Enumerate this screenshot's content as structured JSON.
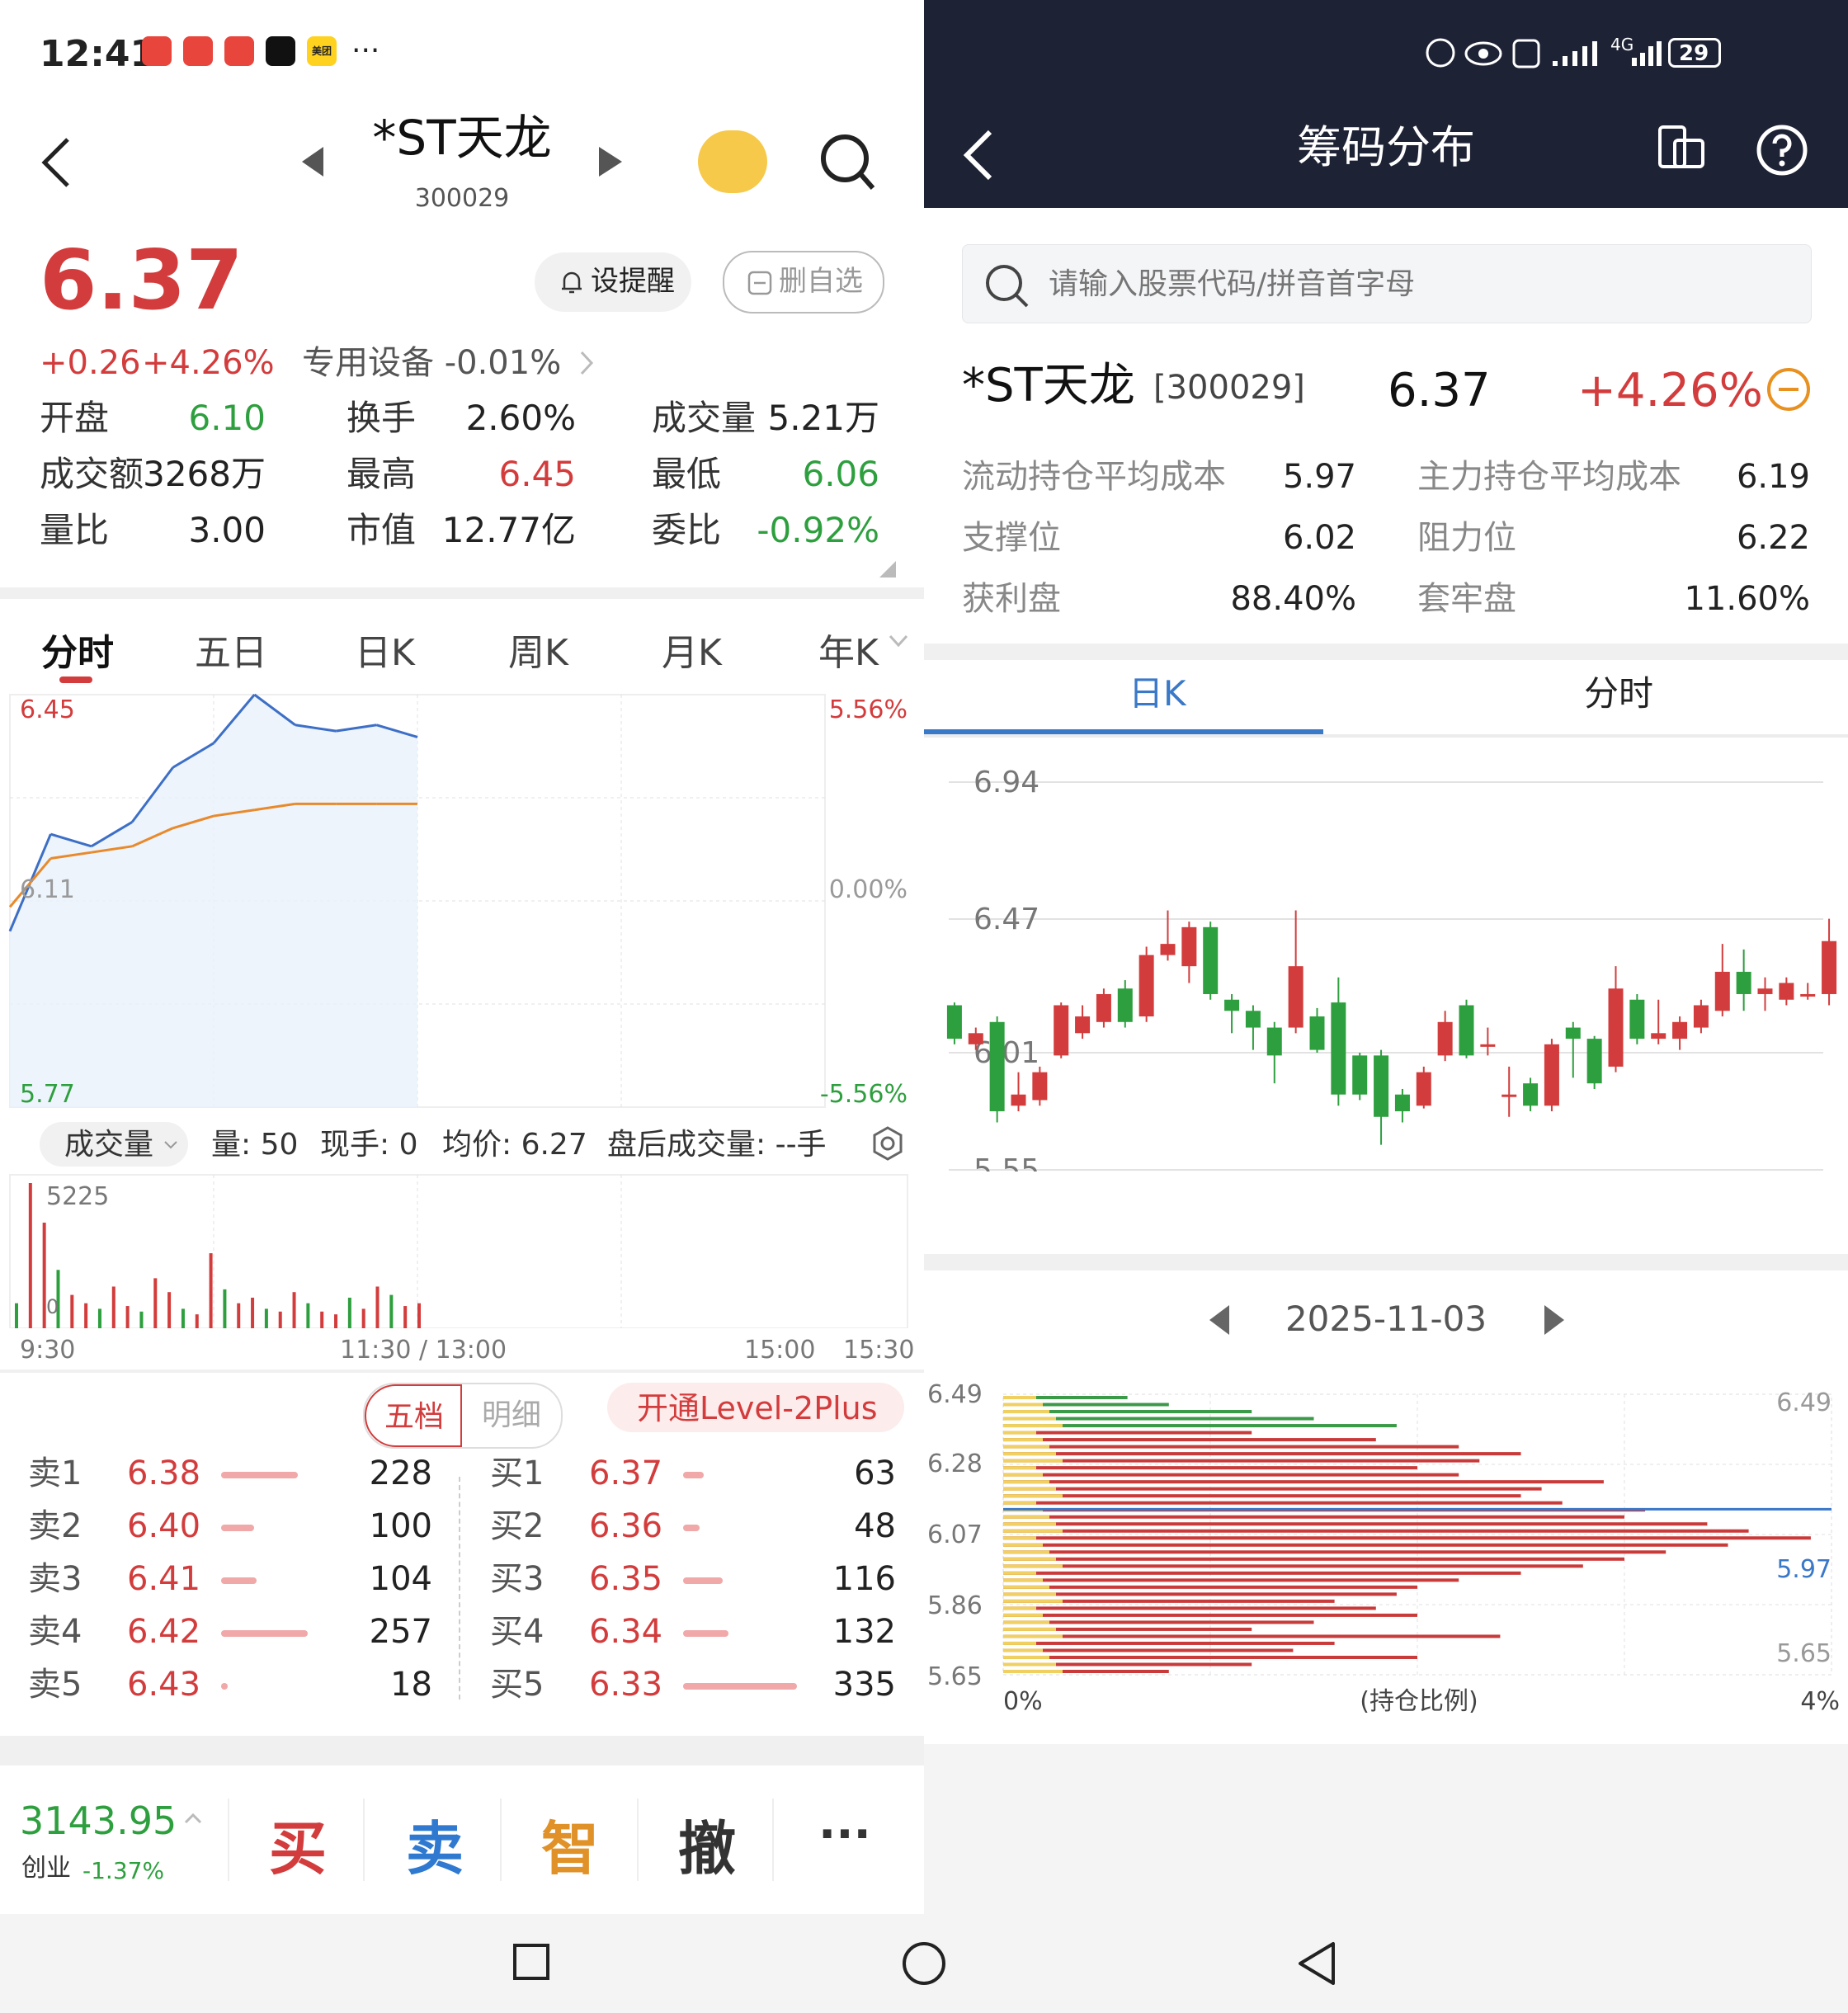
{
  "status_bar": {
    "time": "12:41",
    "more": "···",
    "signal_text": "4G",
    "battery": "29",
    "badge_text": "美团"
  },
  "left": {
    "header": {
      "title": "*ST天龙",
      "code": "300029"
    },
    "price": "6.37",
    "change": "+0.26",
    "change_pct": "+4.26%",
    "remind_label": "设提醒",
    "remove_label": "删自选",
    "sector_text": "专用设备 -0.01%",
    "stats": [
      {
        "label": "开盘",
        "value": "6.10",
        "color": "green"
      },
      {
        "label": "换手",
        "value": "2.60%",
        "color": "black"
      },
      {
        "label": "成交量",
        "value": "5.21万",
        "color": "black"
      },
      {
        "label": "成交额",
        "value": "3268万",
        "color": "black"
      },
      {
        "label": "最高",
        "value": "6.45",
        "color": "red"
      },
      {
        "label": "最低",
        "value": "6.06",
        "color": "green"
      },
      {
        "label": "量比",
        "value": "3.00",
        "color": "black"
      },
      {
        "label": "市值",
        "value": "12.77亿",
        "color": "black"
      },
      {
        "label": "委比",
        "value": "-0.92%",
        "color": "green"
      }
    ],
    "tabs": [
      "分时",
      "五日",
      "日K",
      "周K",
      "月K",
      "年K"
    ],
    "active_tab": "分时",
    "intraday": {
      "y_top": "6.45",
      "y_mid": "6.11",
      "y_bottom": "5.77",
      "pct_top": "5.56%",
      "pct_mid": "0.00%",
      "pct_bottom": "-5.56%",
      "info": {
        "vol_dropdown": "成交量",
        "amount": "量: 50",
        "now": "现手: 0",
        "avg": "均价: 6.27",
        "after": "盘后成交量: --手"
      },
      "vol_max": "5225",
      "vol_min": "0",
      "times": [
        "9:30",
        "11:30 / 13:00",
        "15:00",
        "15:30"
      ]
    },
    "orderbook": {
      "tabs": [
        "五档",
        "明细"
      ],
      "level2": "开通Level-2Plus",
      "asks": [
        {
          "label": "卖1",
          "price": "6.38",
          "vol": "228",
          "bar": 0.37
        },
        {
          "label": "卖2",
          "price": "6.40",
          "vol": "100",
          "bar": 0.16
        },
        {
          "label": "卖3",
          "price": "6.41",
          "vol": "104",
          "bar": 0.17
        },
        {
          "label": "卖4",
          "price": "6.42",
          "vol": "257",
          "bar": 0.42
        },
        {
          "label": "卖5",
          "price": "6.43",
          "vol": "18",
          "bar": 0.03
        }
      ],
      "bids": [
        {
          "label": "买1",
          "price": "6.37",
          "vol": "63",
          "bar": 0.1
        },
        {
          "label": "买2",
          "price": "6.36",
          "vol": "48",
          "bar": 0.08
        },
        {
          "label": "买3",
          "price": "6.35",
          "vol": "116",
          "bar": 0.19
        },
        {
          "label": "买4",
          "price": "6.34",
          "vol": "132",
          "bar": 0.22
        },
        {
          "label": "买5",
          "price": "6.33",
          "vol": "335",
          "bar": 0.55
        }
      ]
    },
    "bottom_bar": {
      "index_value": "3143.95",
      "index_name": "创业",
      "index_change": "-1.37%",
      "buy": "买",
      "sell": "卖",
      "smart": "智",
      "cancel": "撤",
      "more": "···"
    }
  },
  "right": {
    "title": "筹码分布",
    "search_placeholder": "请输入股票代码/拼音首字母",
    "stock_name": "*ST天龙",
    "stock_code": "[300029]",
    "price": "6.37",
    "change_pct": "+4.26%",
    "metrics": [
      {
        "label": "流动持仓平均成本",
        "value": "5.97"
      },
      {
        "label": "主力持仓平均成本",
        "value": "6.19"
      },
      {
        "label": "支撑位",
        "value": "6.02"
      },
      {
        "label": "阻力位",
        "value": "6.22"
      },
      {
        "label": "获利盘",
        "value": "88.40%"
      },
      {
        "label": "套牢盘",
        "value": "11.60%"
      }
    ],
    "tabs": [
      "日K",
      "分时"
    ],
    "active_tab": "日K",
    "kline_labels": [
      "6.94",
      "6.47",
      "6.01",
      "5.55"
    ],
    "date": "2025-11-03",
    "chip": {
      "y_labels_left": [
        "6.49",
        "6.28",
        "6.07",
        "5.86",
        "5.65"
      ],
      "y_labels_right": [
        "6.49",
        "5.97",
        "5.65"
      ],
      "x_left": "0%",
      "x_mid": "(持仓比例)",
      "x_right": "4%"
    }
  },
  "colors": {
    "up": "#d33c3c",
    "down": "#2e9f3e",
    "accent": "#3a78c8",
    "dark_header": "#1e2235"
  },
  "chart_data": [
    {
      "type": "line",
      "title": "分时",
      "x": [
        "9:30",
        "11:30 / 13:00",
        "15:00",
        "15:30"
      ],
      "ylim": [
        5.77,
        6.45
      ],
      "series": [
        {
          "name": "",
          "values": [
            6.06,
            6.22,
            6.2,
            6.24,
            6.33,
            6.37,
            6.45,
            6.4,
            6.39,
            6.4,
            6.38
          ]
        },
        {
          "name": "均价: 6.27",
          "values": [
            6.1,
            6.18,
            6.19,
            6.2,
            6.23,
            6.25,
            6.26,
            6.27,
            6.27,
            6.27,
            6.27
          ]
        }
      ]
    },
    {
      "type": "bar",
      "title": "成交量",
      "ylim": [
        0,
        5225
      ],
      "values": [
        900,
        5225,
        3800,
        2100,
        1200,
        900,
        700,
        1500,
        800,
        600,
        1800,
        1300,
        700,
        500,
        2700,
        1400,
        900,
        1100,
        700,
        600,
        1300,
        900,
        600,
        500,
        1100,
        700,
        1500,
        1200,
        800,
        900
      ]
    },
    {
      "type": "bar",
      "title": "日K",
      "ylim": [
        5.55,
        6.94
      ],
      "candles": [
        {
          "o": 6.14,
          "c": 6.02,
          "h": 6.15,
          "l": 6.0
        },
        {
          "o": 6.0,
          "c": 6.04,
          "h": 6.06,
          "l": 5.98
        },
        {
          "o": 6.08,
          "c": 5.76,
          "h": 6.1,
          "l": 5.72
        },
        {
          "o": 5.78,
          "c": 5.82,
          "h": 5.9,
          "l": 5.76
        },
        {
          "o": 5.8,
          "c": 5.9,
          "h": 5.92,
          "l": 5.78
        },
        {
          "o": 5.96,
          "c": 6.14,
          "h": 6.15,
          "l": 5.95
        },
        {
          "o": 6.04,
          "c": 6.1,
          "h": 6.14,
          "l": 6.02
        },
        {
          "o": 6.08,
          "c": 6.18,
          "h": 6.2,
          "l": 6.06
        },
        {
          "o": 6.2,
          "c": 6.08,
          "h": 6.23,
          "l": 6.06
        },
        {
          "o": 6.1,
          "c": 6.32,
          "h": 6.35,
          "l": 6.08
        },
        {
          "o": 6.32,
          "c": 6.36,
          "h": 6.48,
          "l": 6.3
        },
        {
          "o": 6.28,
          "c": 6.42,
          "h": 6.44,
          "l": 6.22
        },
        {
          "o": 6.42,
          "c": 6.18,
          "h": 6.44,
          "l": 6.16
        },
        {
          "o": 6.16,
          "c": 6.12,
          "h": 6.18,
          "l": 6.04
        },
        {
          "o": 6.12,
          "c": 6.06,
          "h": 6.14,
          "l": 5.98
        },
        {
          "o": 6.06,
          "c": 5.96,
          "h": 6.08,
          "l": 5.86
        },
        {
          "o": 6.06,
          "c": 6.28,
          "h": 6.48,
          "l": 6.04
        },
        {
          "o": 6.1,
          "c": 5.98,
          "h": 6.13,
          "l": 5.97
        },
        {
          "o": 6.15,
          "c": 5.82,
          "h": 6.24,
          "l": 5.78
        },
        {
          "o": 5.96,
          "c": 5.82,
          "h": 5.97,
          "l": 5.8
        },
        {
          "o": 5.96,
          "c": 5.74,
          "h": 5.98,
          "l": 5.64
        },
        {
          "o": 5.82,
          "c": 5.76,
          "h": 5.84,
          "l": 5.72
        },
        {
          "o": 5.78,
          "c": 5.9,
          "h": 5.92,
          "l": 5.77
        },
        {
          "o": 5.96,
          "c": 6.08,
          "h": 6.12,
          "l": 5.94
        },
        {
          "o": 6.14,
          "c": 5.96,
          "h": 6.16,
          "l": 5.95
        },
        {
          "o": 6.0,
          "c": 6.0,
          "h": 6.06,
          "l": 5.96
        },
        {
          "o": 5.82,
          "c": 5.82,
          "h": 5.92,
          "l": 5.74
        },
        {
          "o": 5.86,
          "c": 5.78,
          "h": 5.88,
          "l": 5.76
        },
        {
          "o": 5.78,
          "c": 6.0,
          "h": 6.02,
          "l": 5.76
        },
        {
          "o": 6.06,
          "c": 6.02,
          "h": 6.08,
          "l": 5.88
        },
        {
          "o": 6.02,
          "c": 5.86,
          "h": 6.03,
          "l": 5.84
        },
        {
          "o": 5.92,
          "c": 6.2,
          "h": 6.28,
          "l": 5.9
        },
        {
          "o": 6.16,
          "c": 6.02,
          "h": 6.18,
          "l": 6.0
        },
        {
          "o": 6.02,
          "c": 6.04,
          "h": 6.16,
          "l": 6.0
        },
        {
          "o": 6.02,
          "c": 6.08,
          "h": 6.1,
          "l": 5.98
        },
        {
          "o": 6.06,
          "c": 6.14,
          "h": 6.16,
          "l": 6.04
        },
        {
          "o": 6.12,
          "c": 6.26,
          "h": 6.36,
          "l": 6.1
        },
        {
          "o": 6.26,
          "c": 6.18,
          "h": 6.34,
          "l": 6.12
        },
        {
          "o": 6.18,
          "c": 6.2,
          "h": 6.24,
          "l": 6.12
        },
        {
          "o": 6.16,
          "c": 6.22,
          "h": 6.24,
          "l": 6.14
        },
        {
          "o": 6.18,
          "c": 6.18,
          "h": 6.22,
          "l": 6.16
        },
        {
          "o": 6.18,
          "c": 6.37,
          "h": 6.45,
          "l": 6.14
        }
      ]
    },
    {
      "type": "bar",
      "title": "(持仓比例)",
      "xlim": [
        0,
        4
      ],
      "ylim": [
        5.65,
        6.49
      ],
      "values_pct": [
        0.6,
        0.8,
        1.2,
        1.5,
        1.9,
        1.2,
        1.8,
        2.2,
        2.5,
        2.3,
        2.0,
        2.2,
        2.9,
        2.6,
        2.5,
        2.7,
        3.1,
        3.0,
        3.4,
        3.6,
        3.9,
        3.5,
        3.2,
        3.0,
        2.8,
        2.5,
        2.2,
        2.0,
        1.9,
        1.6,
        1.8,
        2.0,
        1.5,
        1.2,
        2.4,
        1.6,
        1.4,
        2.0,
        1.2,
        0.8
      ]
    }
  ]
}
